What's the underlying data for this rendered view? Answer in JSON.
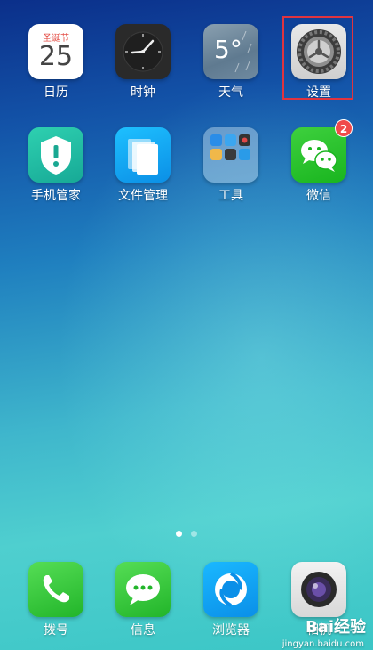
{
  "apps_row1": [
    {
      "label": "日历",
      "calendar_holiday": "圣诞节",
      "calendar_day": "25"
    },
    {
      "label": "时钟"
    },
    {
      "label": "天气",
      "weather_temp": "5°"
    },
    {
      "label": "设置"
    }
  ],
  "apps_row2": [
    {
      "label": "手机管家"
    },
    {
      "label": "文件管理"
    },
    {
      "label": "工具"
    },
    {
      "label": "微信",
      "badge": "2"
    }
  ],
  "dock": [
    {
      "label": "拨号"
    },
    {
      "label": "信息"
    },
    {
      "label": "浏览器"
    },
    {
      "label": "相机"
    }
  ],
  "page_indicator": {
    "pages": 2,
    "current": 1
  },
  "watermark": {
    "brand": "Bai经验",
    "url": "jingyan.baidu.com"
  },
  "colors": {
    "highlight": "#e0343f",
    "badge": "#f04a4a"
  }
}
